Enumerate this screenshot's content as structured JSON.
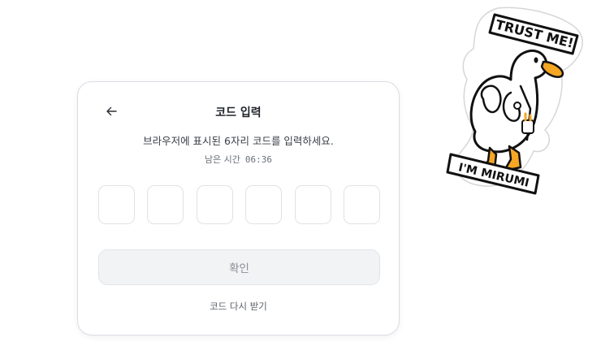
{
  "dialog": {
    "title": "코드 입력",
    "instruction": "브라우저에 표시된 6자리 코드를 입력하세요.",
    "timer_label": "남은 시간",
    "timer_value": "06:36",
    "code_digits": [
      "",
      "",
      "",
      "",
      "",
      ""
    ],
    "confirm_label": "확인",
    "resend_label": "코드 다시 받기"
  },
  "sticker": {
    "top_text": "TRUST ME!",
    "bottom_text": "I'M MIRUMI"
  },
  "colors": {
    "card_border": "#d9dde3",
    "button_bg": "#f2f3f5",
    "button_text": "#8a8f96",
    "duck_beak": "#f5a623"
  }
}
